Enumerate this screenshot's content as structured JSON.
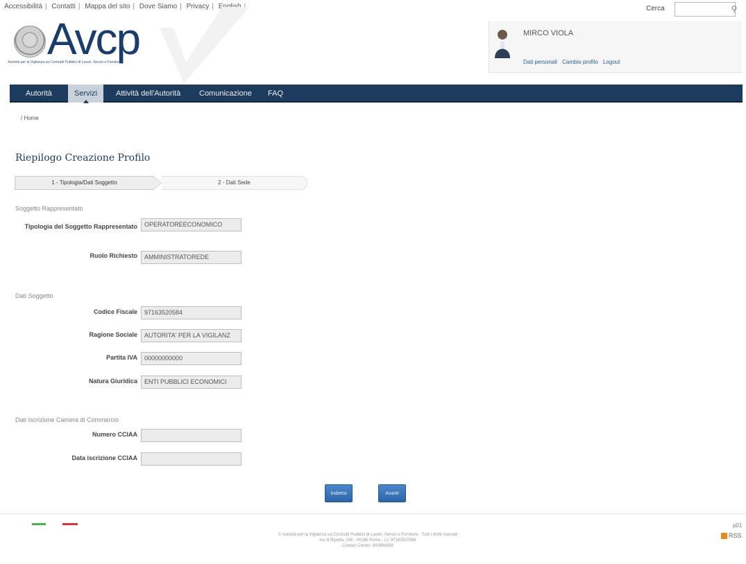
{
  "toplinks": [
    "Accessibilità",
    "Contatti",
    "Mappa del sito",
    "Dove Siamo",
    "Privacy",
    "English"
  ],
  "search": {
    "label": "Cerca",
    "placeholder": ""
  },
  "logo": {
    "text": "Avcp",
    "caption": "Autorità per la Vigilanza sui Contratti Pubblici di Lavori, Servizi e Forniture"
  },
  "user": {
    "name": "MIRCO VIOLA",
    "links": [
      "Dati personali",
      "Cambio profilo",
      "Logout"
    ]
  },
  "nav": [
    "Autorità",
    "Servizi",
    "Attività dell'Autorità",
    "Comunicazione",
    "FAQ"
  ],
  "nav_active": "Servizi",
  "breadcrumb": "/ Home",
  "page_title": "Riepilogo Creazione Profilo",
  "steps": [
    "1 - Tipologia/Dati Soggetto",
    "2 - Dati Sede"
  ],
  "sections": {
    "soggetto": {
      "title": "Soggetto Rappresentato",
      "tipologia_label": "Tipologia del Soggetto Rappresentato",
      "tipologia_value": "OPERATOREECONOMICO",
      "ruolo_label": "Ruolo Richiesto",
      "ruolo_value": "AMMINISTRATOREDE"
    },
    "dati": {
      "title": "Dati Soggetto",
      "cf_label": "Codice Fiscale",
      "cf_value": "97163520584",
      "rs_label": "Ragione Sociale",
      "rs_value": "AUTORITA' PER LA VIGILANZ",
      "piva_label": "Partita IVA",
      "piva_value": "00000000000",
      "nat_label": "Natura Giuridica",
      "nat_value": "ENTI PUBBLICI ECONOMICI"
    },
    "cciaa": {
      "title": "Dati Iscrizione Camera di Commercio",
      "num_label": "Numero CCIAA",
      "num_value": "",
      "data_label": "Data iscrizione CCIAA",
      "data_value": ""
    }
  },
  "buttons": {
    "back": "Indietro",
    "next": "Avanti"
  },
  "footer": {
    "line1": "© Autorità per la Vigilanza sui Contratti Pubblici di Lavori, Servizi e Forniture - Tutti i diritti riservati",
    "line2": "via di Ripetta, 246 - 00186 Roma - c.f. 97163520584",
    "line3": "Contact Center: 800896936",
    "version": "p01",
    "rss": "RSS"
  },
  "colors": {
    "navbar": "#1d3b5c",
    "accent_button": "#2d65a8"
  }
}
